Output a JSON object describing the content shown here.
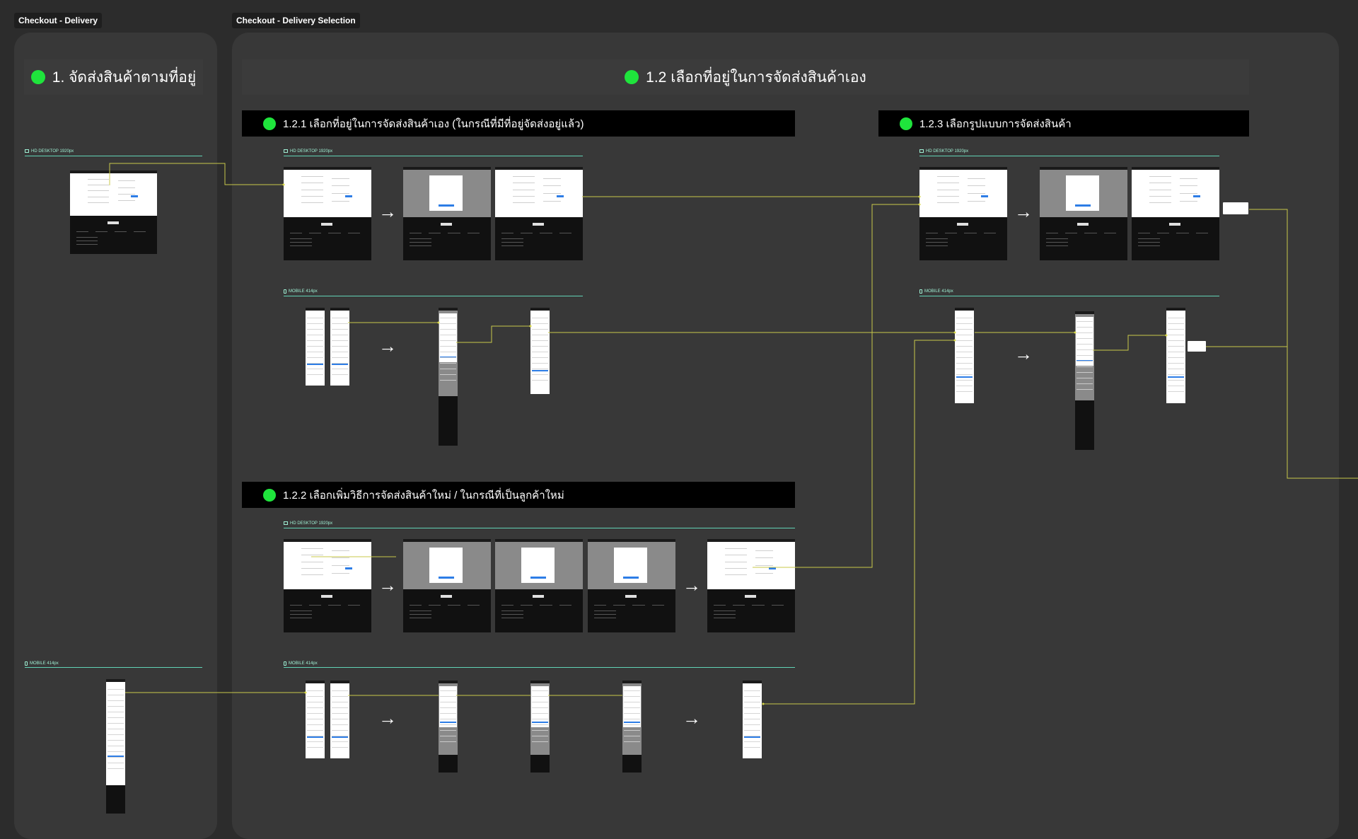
{
  "frames": {
    "delivery_label": "Checkout - Delivery",
    "selection_label": "Checkout - Delivery Selection"
  },
  "sections": {
    "s1_title": "1. จัดส่งสินค้าตามที่อยู่",
    "s12_title": "1.2 เลือกที่อยู่ในการจัดส่งสินค้าเอง",
    "s121_title": "1.2.1 เลือกที่อยู่ในการจัดส่งสินค้าเอง (ในกรณีที่มีที่อยู่จัดส่งอยู่แล้ว)",
    "s122_title": "1.2.2 เลือกเพิ่มวิธีการจัดส่งสินค้าใหม่ / ในกรณีที่เป็นลูกค้าใหม่",
    "s123_title": "1.2.3 เลือกรูปแบบการจัดส่งสินค้า"
  },
  "devices": {
    "desktop": "HD DESKTOP 1920px",
    "mobile": "MOBILE 414px"
  },
  "icons": {
    "status_dot": "green-dot-icon",
    "desktop": "monitor-icon",
    "mobile": "phone-icon",
    "flow_arrow": "right-arrow-icon"
  },
  "colors": {
    "canvas": "#2c2c2c",
    "section_bg": "#383838",
    "status_green": "#1fe43c",
    "device_line": "#61d3b6",
    "connector": "#e8e84a"
  }
}
